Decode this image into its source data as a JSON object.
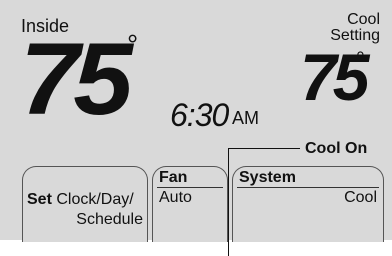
{
  "display": {
    "inside_label": "Inside",
    "inside_temp": "75",
    "degree_symbol": "°",
    "time": "6:30",
    "ampm": "AM",
    "setting_label_line1": "Cool",
    "setting_label_line2": "Setting",
    "set_temp": "75",
    "mode_status": "Cool On"
  },
  "buttons": {
    "set": {
      "bold": "Set",
      "line1_rest": " Clock/Day/",
      "line2": "Schedule"
    },
    "fan": {
      "title": "Fan",
      "value": "Auto"
    },
    "system": {
      "title": "System",
      "value": "Cool"
    }
  },
  "colors": {
    "screen": "#d9d9d9",
    "text": "#111111"
  }
}
